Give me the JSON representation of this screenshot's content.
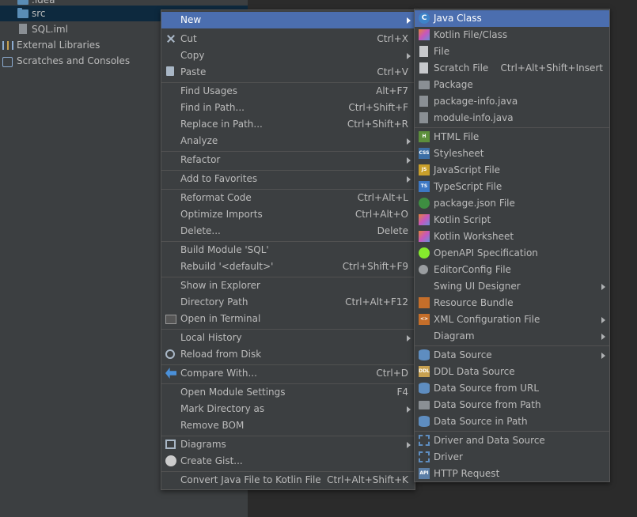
{
  "tree": {
    "items": [
      {
        "label": ".idea",
        "icon": "folder-icon"
      },
      {
        "label": "src",
        "icon": "folder-icon"
      },
      {
        "label": "SQL.iml",
        "icon": "iml-file-icon"
      },
      {
        "label": "External Libraries",
        "icon": "libraries-icon"
      },
      {
        "label": "Scratches and Consoles",
        "icon": "scratches-icon"
      }
    ]
  },
  "context_menu": {
    "items": [
      {
        "label": "New",
        "shortcut": "",
        "submenu": true,
        "highlighted": true
      },
      {
        "label": "Cut",
        "shortcut": "Ctrl+X",
        "icon": "scissors-icon"
      },
      {
        "label": "Copy",
        "shortcut": "",
        "submenu": true
      },
      {
        "label": "Paste",
        "shortcut": "Ctrl+V",
        "icon": "clipboard-icon"
      },
      {
        "label": "Find Usages",
        "shortcut": "Alt+F7"
      },
      {
        "label": "Find in Path...",
        "shortcut": "Ctrl+Shift+F"
      },
      {
        "label": "Replace in Path...",
        "shortcut": "Ctrl+Shift+R"
      },
      {
        "label": "Analyze",
        "shortcut": "",
        "submenu": true
      },
      {
        "label": "Refactor",
        "shortcut": "",
        "submenu": true
      },
      {
        "label": "Add to Favorites",
        "shortcut": "",
        "submenu": true
      },
      {
        "label": "Reformat Code",
        "shortcut": "Ctrl+Alt+L"
      },
      {
        "label": "Optimize Imports",
        "shortcut": "Ctrl+Alt+O"
      },
      {
        "label": "Delete...",
        "shortcut": "Delete"
      },
      {
        "label": "Build Module 'SQL'",
        "shortcut": ""
      },
      {
        "label": "Rebuild '<default>'",
        "shortcut": "Ctrl+Shift+F9"
      },
      {
        "label": "Show in Explorer",
        "shortcut": ""
      },
      {
        "label": "Directory Path",
        "shortcut": "Ctrl+Alt+F12"
      },
      {
        "label": "Open in Terminal",
        "shortcut": "",
        "icon": "terminal-icon"
      },
      {
        "label": "Local History",
        "shortcut": "",
        "submenu": true
      },
      {
        "label": "Reload from Disk",
        "shortcut": "",
        "icon": "reload-icon"
      },
      {
        "label": "Compare With...",
        "shortcut": "Ctrl+D",
        "icon": "compare-icon"
      },
      {
        "label": "Open Module Settings",
        "shortcut": "F4"
      },
      {
        "label": "Mark Directory as",
        "shortcut": "",
        "submenu": true
      },
      {
        "label": "Remove BOM",
        "shortcut": ""
      },
      {
        "label": "Diagrams",
        "shortcut": "",
        "submenu": true,
        "icon": "diagrams-icon"
      },
      {
        "label": "Create Gist...",
        "shortcut": "",
        "icon": "github-icon"
      },
      {
        "label": "Convert Java File to Kotlin File",
        "shortcut": "Ctrl+Alt+Shift+K"
      }
    ]
  },
  "new_submenu": {
    "items": [
      {
        "label": "Java Class",
        "shortcut": "",
        "highlighted": true,
        "icon": "java-class-icon"
      },
      {
        "label": "Kotlin File/Class",
        "shortcut": "",
        "icon": "kotlin-icon"
      },
      {
        "label": "File",
        "shortcut": "",
        "icon": "file-icon"
      },
      {
        "label": "Scratch File",
        "shortcut": "Ctrl+Alt+Shift+Insert",
        "icon": "scratch-file-icon"
      },
      {
        "label": "Package",
        "shortcut": "",
        "icon": "package-icon"
      },
      {
        "label": "package-info.java",
        "shortcut": "",
        "icon": "java-file-icon"
      },
      {
        "label": "module-info.java",
        "shortcut": "",
        "icon": "java-file-icon"
      },
      {
        "label": "HTML File",
        "shortcut": "",
        "icon": "html-icon",
        "badge": "H"
      },
      {
        "label": "Stylesheet",
        "shortcut": "",
        "icon": "css-icon",
        "badge": "CSS"
      },
      {
        "label": "JavaScript File",
        "shortcut": "",
        "icon": "js-icon",
        "badge": "JS"
      },
      {
        "label": "TypeScript File",
        "shortcut": "",
        "icon": "ts-icon",
        "badge": "TS"
      },
      {
        "label": "package.json File",
        "shortcut": "",
        "icon": "nodejs-icon"
      },
      {
        "label": "Kotlin Script",
        "shortcut": "",
        "icon": "kotlin-script-icon"
      },
      {
        "label": "Kotlin Worksheet",
        "shortcut": "",
        "icon": "kotlin-worksheet-icon"
      },
      {
        "label": "OpenAPI Specification",
        "shortcut": "",
        "icon": "openapi-icon"
      },
      {
        "label": "EditorConfig File",
        "shortcut": "",
        "icon": "gear-icon"
      },
      {
        "label": "Swing UI Designer",
        "shortcut": "",
        "submenu": true
      },
      {
        "label": "Resource Bundle",
        "shortcut": "",
        "icon": "resource-bundle-icon"
      },
      {
        "label": "XML Configuration File",
        "shortcut": "",
        "submenu": true,
        "icon": "xml-icon",
        "badge": "<>"
      },
      {
        "label": "Diagram",
        "shortcut": "",
        "submenu": true
      },
      {
        "label": "Data Source",
        "shortcut": "",
        "submenu": true,
        "icon": "database-icon"
      },
      {
        "label": "DDL Data Source",
        "shortcut": "",
        "icon": "ddl-icon",
        "badge": "DDL"
      },
      {
        "label": "Data Source from URL",
        "shortcut": "",
        "icon": "database-url-icon"
      },
      {
        "label": "Data Source from Path",
        "shortcut": "",
        "icon": "folder-open-icon"
      },
      {
        "label": "Data Source in Path",
        "shortcut": "",
        "icon": "database-icon"
      },
      {
        "label": "Driver and Data Source",
        "shortcut": "",
        "icon": "driver-datasource-icon"
      },
      {
        "label": "Driver",
        "shortcut": "",
        "icon": "driver-icon"
      },
      {
        "label": "HTTP Request",
        "shortcut": "",
        "icon": "http-request-icon",
        "badge": "API"
      }
    ]
  },
  "colors": {
    "menu_bg": "#3c3f41",
    "highlight": "#4b6eaf",
    "editor_bg": "#2b2b2b",
    "text": "#bbbbbb"
  }
}
